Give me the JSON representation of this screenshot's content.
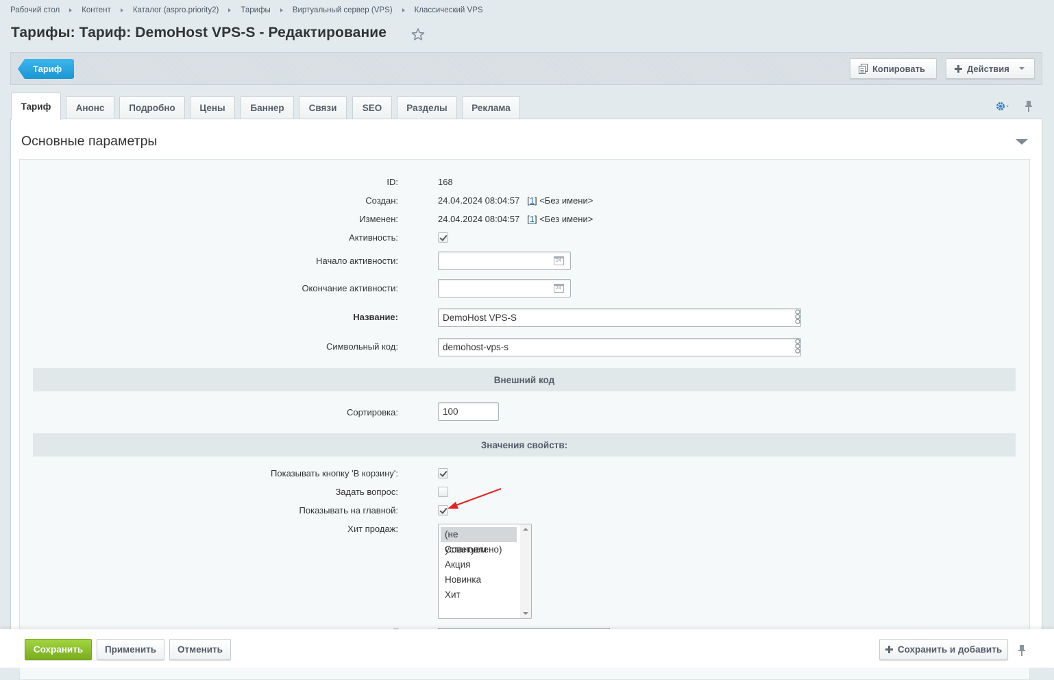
{
  "breadcrumbs": [
    "Рабочий стол",
    "Контент",
    "Каталог (aspro.priority2)",
    "Тарифы",
    "Виртуальный сервер (VPS)",
    "Классический VPS"
  ],
  "page": {
    "title": "Тарифы: Тариф: DemoHost VPS-S - Редактирование"
  },
  "toolbar": {
    "flag_label": "Тариф",
    "copy_label": "Копировать",
    "actions_label": "Действия"
  },
  "tabs": [
    "Тариф",
    "Анонс",
    "Подробно",
    "Цены",
    "Баннер",
    "Связи",
    "SEO",
    "Разделы",
    "Реклама"
  ],
  "section": {
    "title": "Основные параметры"
  },
  "fields": {
    "id": {
      "label": "ID:",
      "value": "168"
    },
    "created": {
      "label": "Создан:",
      "date": "24.04.2024 08:04:57",
      "user_id": "1",
      "user_name": "<Без имени>"
    },
    "modified": {
      "label": "Изменен:",
      "date": "24.04.2024 08:04:57",
      "user_id": "1",
      "user_name": "<Без имени>"
    },
    "active": {
      "label": "Активность:",
      "checked": true
    },
    "active_from": {
      "label": "Начало активности:",
      "value": ""
    },
    "active_to": {
      "label": "Окончание активности:",
      "value": ""
    },
    "name": {
      "label": "Название:",
      "value": "DemoHost VPS-S"
    },
    "code": {
      "label": "Символьный код:",
      "value": "demohost-vps-s"
    },
    "sort": {
      "label": "Сортировка:",
      "value": "100"
    }
  },
  "bands": {
    "external_code": "Внешний код",
    "properties": "Значения свойств:"
  },
  "properties": {
    "show_cart": {
      "label": "Показывать кнопку 'В корзину':",
      "checked": true
    },
    "ask_question": {
      "label": "Задать вопрос:",
      "checked": false
    },
    "show_main": {
      "label": "Показывать на главной:",
      "checked": true
    },
    "hit": {
      "label": "Хит продаж:",
      "options": [
        "(не установлено)",
        "Советуем",
        "Акция",
        "Новинка",
        "Хит"
      ],
      "selected": "(не установлено)"
    }
  },
  "footer": {
    "save_label": "Сохранить",
    "apply_label": "Применить",
    "cancel_label": "Отменить",
    "save_add_label": "Сохранить и добавить"
  },
  "colors": {
    "accent_blue": "#1a96d4",
    "save_green": "#79ad1c",
    "annotation_red": "#e52222"
  }
}
